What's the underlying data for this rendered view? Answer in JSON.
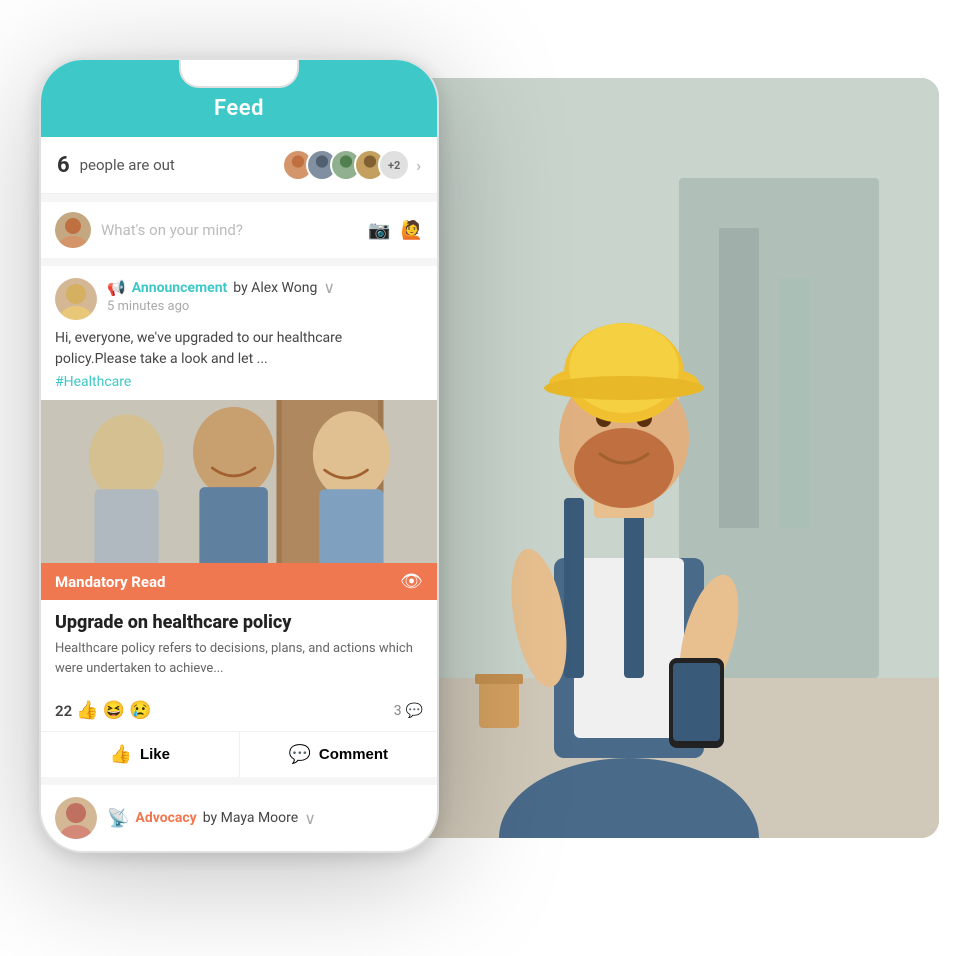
{
  "header": {
    "title": "Feed"
  },
  "people_out": {
    "count": "6",
    "label": "people are out",
    "plus": "+2"
  },
  "post_input": {
    "placeholder": "What's on your mind?"
  },
  "announcement_card": {
    "type_label": "Announcement",
    "author": "by Alex Wong",
    "time": "5 minutes ago",
    "body": "Hi, everyone, we've upgraded to our healthcare policy.Please take a look and let ...",
    "hashtag": "#Healthcare",
    "mandatory_label": "Mandatory Read",
    "post_title": "Upgrade on healthcare policy",
    "post_excerpt": "Healthcare policy refers to decisions, plans, and actions which were undertaken to achieve...",
    "reaction_count": "22",
    "reactions": [
      "👍",
      "😆",
      "😢"
    ],
    "comment_count": "3",
    "like_label": "Like",
    "comment_label": "Comment"
  },
  "advocacy_card": {
    "type_label": "Advocacy",
    "author": "by Maya Moore"
  },
  "avatars": [
    {
      "color": "#d4956a",
      "initials": ""
    },
    {
      "color": "#8090a0",
      "initials": ""
    },
    {
      "color": "#90b090",
      "initials": ""
    },
    {
      "color": "#c4a060",
      "initials": ""
    },
    {
      "plus": "+2"
    }
  ]
}
